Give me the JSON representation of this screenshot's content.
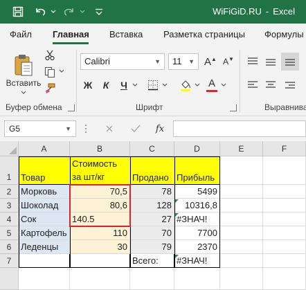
{
  "titlebar": {
    "doc_name": "WiFiGiD.RU",
    "separator": "-",
    "app_name": "Excel",
    "color": "#217346"
  },
  "menu": {
    "tabs": [
      {
        "label": "Файл"
      },
      {
        "label": "Главная"
      },
      {
        "label": "Вставка"
      },
      {
        "label": "Разметка страницы"
      },
      {
        "label": "Формулы"
      }
    ],
    "active_index": 1
  },
  "ribbon": {
    "clipboard": {
      "paste_label": "Вставить",
      "group_label": "Буфер обмена"
    },
    "font": {
      "font_name": "Calibri",
      "font_size": "11",
      "bold": "Ж",
      "italic": "К",
      "underline": "Ч",
      "grow": "A",
      "shrink": "A",
      "font_color": "A",
      "font_color_hex": "#e0202a",
      "group_label": "Шрифт"
    },
    "alignment": {
      "group_label": "Выравнива"
    }
  },
  "formula_bar": {
    "name_box": "G5",
    "fx_label": "fx",
    "formula": ""
  },
  "sheet": {
    "columns": [
      "A",
      "B",
      "C",
      "D",
      "E",
      "F"
    ],
    "rows": [
      "1",
      "2",
      "3",
      "4",
      "5",
      "6",
      "7"
    ],
    "header_a1": "Товар",
    "header_b1_line1": "Стоимость",
    "header_b1_line2": "за шт/кг",
    "header_c1": "Продано",
    "header_d1": "Прибыль",
    "data": [
      {
        "name": "Морковь",
        "price": "70,5",
        "sold": "78",
        "profit": "5499"
      },
      {
        "name": "Шоколад",
        "price": "80,6",
        "sold": "128",
        "profit": "10316,8"
      },
      {
        "name": "Сок",
        "price": "140.5",
        "sold": "27",
        "profit": "#ЗНАЧ!"
      },
      {
        "name": "Картофель",
        "price": "110",
        "sold": "70",
        "profit": "7700"
      },
      {
        "name": "Леденцы",
        "price": "30",
        "sold": "79",
        "profit": "2370"
      }
    ],
    "total_label": "Всего:",
    "total_value": "#ЗНАЧ!",
    "highlight_color": "#ffff00",
    "error_border_color": "#e0202a"
  }
}
